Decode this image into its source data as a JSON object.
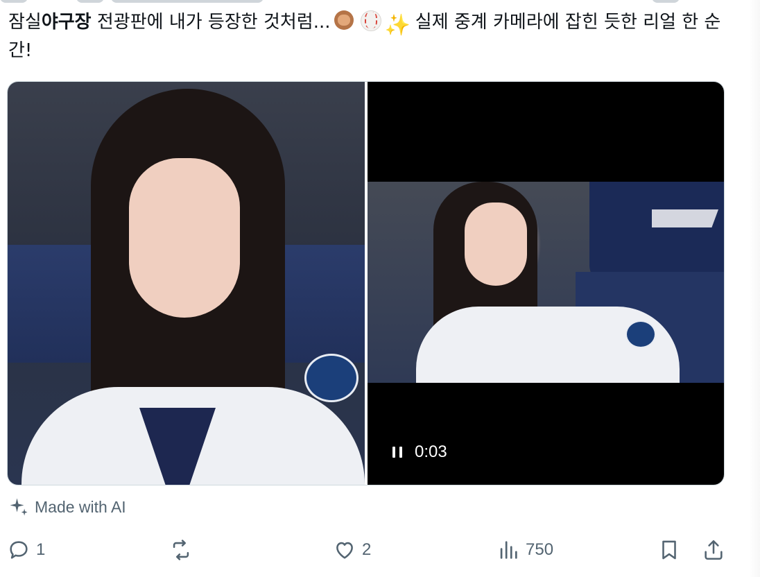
{
  "tweet": {
    "text_before": "잠실",
    "text_bold": "야구장",
    "text_after": " 전광판에 내가 등장한 것처럼...",
    "emojis": [
      "see-no-evil-monkey",
      "baseball",
      "sparkles"
    ],
    "text_tail": " 실제 중계 카메라에 잡힌 듯한 리얼 한 순간!"
  },
  "video": {
    "time": "0:03",
    "state": "playing"
  },
  "ai_label": "Made with AI",
  "actions": {
    "reply_count": "1",
    "repost_count": "",
    "like_count": "2",
    "views_count": "750"
  },
  "colors": {
    "text": "#0f1419",
    "muted": "#536471",
    "border": "#cfd9de",
    "video_bg": "#000000"
  },
  "icons": [
    "sparkle-icon",
    "reply-icon",
    "repost-icon",
    "like-icon",
    "views-icon",
    "bookmark-icon",
    "share-icon",
    "pause-icon"
  ]
}
